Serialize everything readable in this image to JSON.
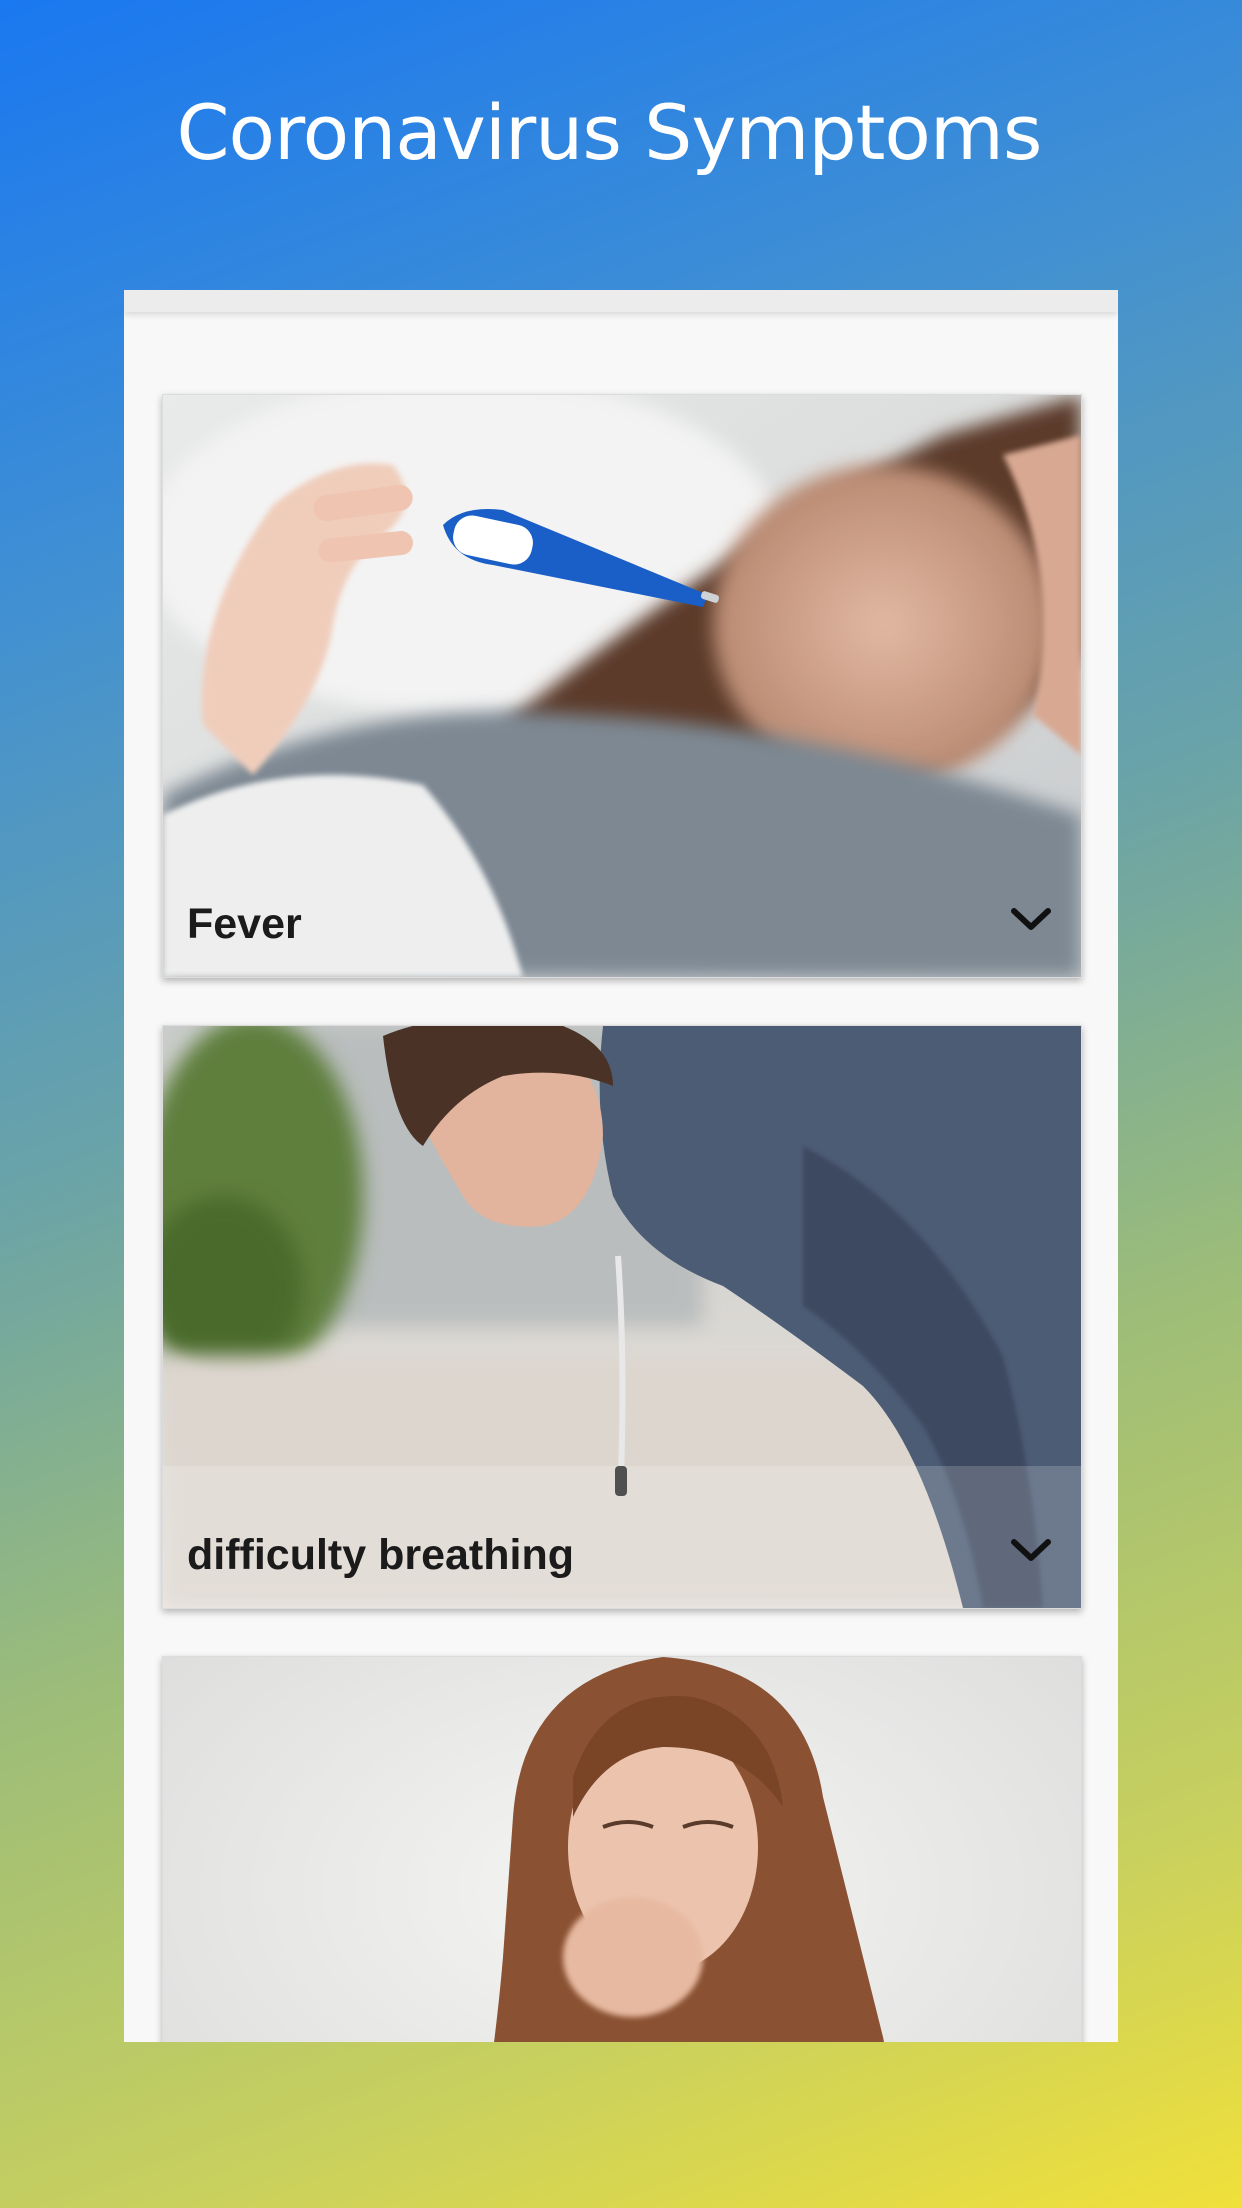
{
  "header": {
    "title": "Coronavirus Symptoms"
  },
  "cards": [
    {
      "label": "Fever",
      "icon": "chevron-down-icon"
    },
    {
      "label": "difficulty breathing",
      "icon": "chevron-down-icon"
    },
    {
      "label": "",
      "icon": ""
    }
  ],
  "colors": {
    "gradient_start": "#1a78f0",
    "gradient_end": "#f0e03a",
    "title_text": "#ffffff",
    "label_text": "#1b1b1b"
  }
}
